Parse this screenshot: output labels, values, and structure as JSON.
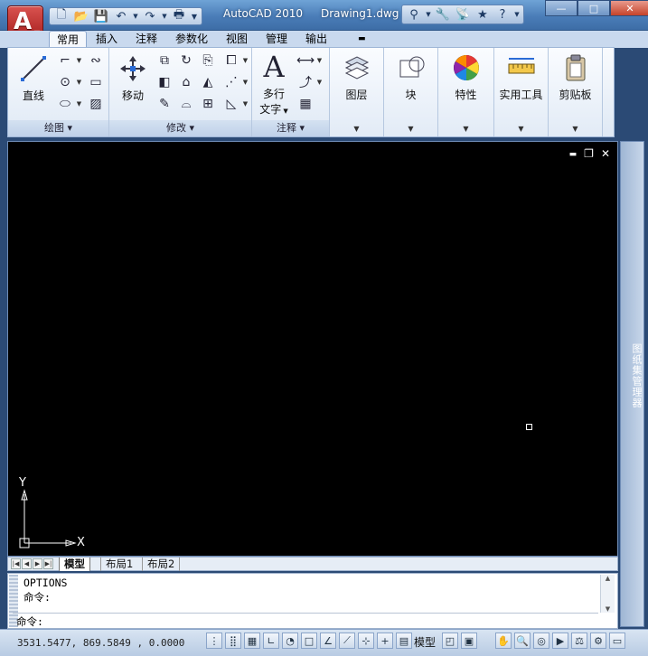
{
  "app": {
    "title": "AutoCAD 2010",
    "document": "Drawing1.dwg",
    "menu_letter": "A"
  },
  "quick_access": [
    "new-icon",
    "open-icon",
    "save-icon",
    "undo-icon",
    "redo-icon",
    "plot-icon"
  ],
  "infocenter": [
    "binoculars-icon",
    "wrench-icon",
    "satellite-icon",
    "star-icon",
    "help-icon"
  ],
  "window_controls": {
    "minimize": "—",
    "maximize": "□",
    "close": "✕"
  },
  "tabs": [
    {
      "label": "常用",
      "active": true
    },
    {
      "label": "插入",
      "active": false
    },
    {
      "label": "注释",
      "active": false
    },
    {
      "label": "参数化",
      "active": false
    },
    {
      "label": "视图",
      "active": false
    },
    {
      "label": "管理",
      "active": false
    },
    {
      "label": "输出",
      "active": false
    }
  ],
  "ribbon": {
    "draw": {
      "title": "绘图",
      "line_label": "直线"
    },
    "modify": {
      "title": "修改",
      "move_label": "移动"
    },
    "annotation": {
      "title": "注释",
      "mtext_label_1": "多行",
      "mtext_label_2": "文字"
    },
    "tiles": [
      {
        "label": "图层"
      },
      {
        "label": "块"
      },
      {
        "label": "特性"
      },
      {
        "label": "实用工具"
      },
      {
        "label": "剪贴板"
      }
    ]
  },
  "drawing_area": {
    "background": "#000000",
    "ucs": {
      "x_label": "X",
      "y_label": "Y"
    },
    "controls": {
      "minimize": "▬",
      "restore": "❐",
      "close": "✕"
    }
  },
  "palette": {
    "label": "图纸集管理器"
  },
  "layout_tabs": [
    {
      "label": "模型",
      "active": true
    },
    {
      "label": "布局1",
      "active": false
    },
    {
      "label": "布局2",
      "active": false
    }
  ],
  "command": {
    "history": [
      "OPTIONS",
      "命令:"
    ],
    "prompt": "命令:"
  },
  "status": {
    "coordinates": "3531.5477, 869.5849 , 0.0000",
    "model_label": "模型"
  }
}
